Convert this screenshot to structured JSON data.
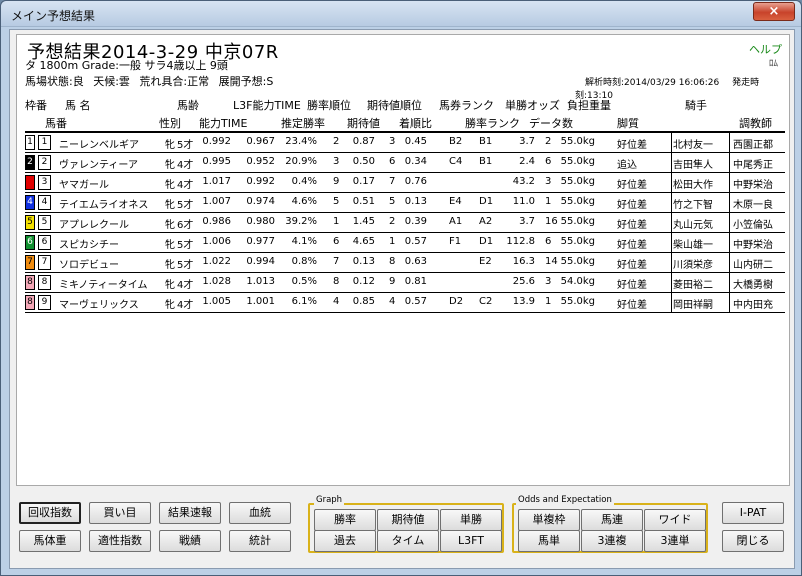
{
  "window": {
    "title": "メイン予想結果",
    "close_icon": "×"
  },
  "race": {
    "title": "予想結果2014-3-29 中京07R",
    "info": "タ 1800m  Grade:一般 サラ4歳以上 9頭",
    "conditions": "馬場状態:良  天候:雲  荒れ具合:正常  展開予想:S",
    "help": "ヘルプ",
    "help_small": "ﾛﾑ",
    "analysis_time": "解析時刻:2014/03/29 16:06:26",
    "post_time": "発走時刻:13:10"
  },
  "headers": {
    "row1": {
      "waku": "枠番",
      "uma": "馬 名",
      "age": "馬齢",
      "l3f": "L3F能力TIME",
      "rate_rank": "勝率順位",
      "exp_rank": "期待値順位",
      "ticket_rank": "馬券ランク",
      "odds": "単勝オッズ",
      "weight": "負担重量",
      "jockey": "騎手"
    },
    "row2": {
      "umaban": "馬番",
      "sex": "性別",
      "ability": "能力TIME",
      "win_rate": "推定勝率",
      "exp": "期待値",
      "finish": "着順比",
      "win_rank": "勝率ランク",
      "data_count": "データ数",
      "leg": "脚質",
      "trainer": "調教師"
    }
  },
  "horses": [
    {
      "waku": "1",
      "waku_color": "#ffffff",
      "waku_text": "#000000",
      "umaban": "1",
      "name": "ニーレンベルギア",
      "sex": "牝",
      "age": "5才",
      "ability": "0.992",
      "l3f": "0.967",
      "rate": "23.4%",
      "rate_rank": "2",
      "exp": "0.87",
      "exp_rank": "3",
      "finish": "0.45",
      "ticket": "B2",
      "win_rank": "B1",
      "odds": "3.7",
      "data": "2",
      "weight": "55.0kg",
      "leg": "好位差",
      "jockey": "北村友一",
      "trainer": "西園正都"
    },
    {
      "waku": "2",
      "waku_color": "#000000",
      "waku_text": "#ffffff",
      "umaban": "2",
      "name": "ヴァレンティーア",
      "sex": "牝",
      "age": "4才",
      "ability": "0.995",
      "l3f": "0.952",
      "rate": "20.9%",
      "rate_rank": "3",
      "exp": "0.50",
      "exp_rank": "6",
      "finish": "0.34",
      "ticket": "C4",
      "win_rank": "B1",
      "odds": "2.4",
      "data": "6",
      "weight": "55.0kg",
      "leg": "追込",
      "jockey": "吉田隼人",
      "trainer": "中尾秀正"
    },
    {
      "waku": "3",
      "waku_color": "#e00000",
      "waku_text": "#e00000",
      "umaban": "3",
      "name": "ヤマガール",
      "sex": "牝",
      "age": "4才",
      "ability": "1.017",
      "l3f": "0.992",
      "rate": "0.4%",
      "rate_rank": "9",
      "exp": "0.17",
      "exp_rank": "7",
      "finish": "0.76",
      "ticket": "",
      "win_rank": "",
      "odds": "43.2",
      "data": "3",
      "weight": "55.0kg",
      "leg": "好位差",
      "jockey": "松田大作",
      "trainer": "中野栄治"
    },
    {
      "waku": "4",
      "waku_color": "#1030e0",
      "waku_text": "#ffffff",
      "umaban": "4",
      "name": "テイエムライオネス",
      "sex": "牝",
      "age": "5才",
      "ability": "1.007",
      "l3f": "0.974",
      "rate": "4.6%",
      "rate_rank": "5",
      "exp": "0.51",
      "exp_rank": "5",
      "finish": "0.13",
      "ticket": "E4",
      "win_rank": "D1",
      "odds": "11.0",
      "data": "1",
      "weight": "55.0kg",
      "leg": "好位差",
      "jockey": "竹之下智",
      "trainer": "木原一良"
    },
    {
      "waku": "5",
      "waku_color": "#f4e000",
      "waku_text": "#000000",
      "umaban": "5",
      "name": "アプレレクール",
      "sex": "牝",
      "age": "6才",
      "ability": "0.986",
      "l3f": "0.980",
      "rate": "39.2%",
      "rate_rank": "1",
      "exp": "1.45",
      "exp_rank": "2",
      "finish": "0.39",
      "ticket": "A1",
      "win_rank": "A2",
      "odds": "3.7",
      "data": "16",
      "weight": "55.0kg",
      "leg": "好位差",
      "jockey": "丸山元気",
      "trainer": "小笠倫弘"
    },
    {
      "waku": "6",
      "waku_color": "#109030",
      "waku_text": "#ffffff",
      "umaban": "6",
      "name": "スピカシチー",
      "sex": "牝",
      "age": "5才",
      "ability": "1.006",
      "l3f": "0.977",
      "rate": "4.1%",
      "rate_rank": "6",
      "exp": "4.65",
      "exp_rank": "1",
      "finish": "0.57",
      "ticket": "F1",
      "win_rank": "D1",
      "odds": "112.8",
      "data": "6",
      "weight": "55.0kg",
      "leg": "好位差",
      "jockey": "柴山雄一",
      "trainer": "中野栄治"
    },
    {
      "waku": "7",
      "waku_color": "#f08c10",
      "waku_text": "#000000",
      "umaban": "7",
      "name": "ソロデビュー",
      "sex": "牝",
      "age": "5才",
      "ability": "1.022",
      "l3f": "0.994",
      "rate": "0.8%",
      "rate_rank": "7",
      "exp": "0.13",
      "exp_rank": "8",
      "finish": "0.63",
      "ticket": "",
      "win_rank": "E2",
      "odds": "16.3",
      "data": "14",
      "weight": "55.0kg",
      "leg": "好位差",
      "jockey": "川須栄彦",
      "trainer": "山内研二"
    },
    {
      "waku": "8",
      "waku_color": "#f4a8b8",
      "waku_text": "#000000",
      "umaban": "8",
      "name": "ミキノティータイム",
      "sex": "牝",
      "age": "4才",
      "ability": "1.028",
      "l3f": "1.013",
      "rate": "0.5%",
      "rate_rank": "8",
      "exp": "0.12",
      "exp_rank": "9",
      "finish": "0.81",
      "ticket": "",
      "win_rank": "",
      "odds": "25.6",
      "data": "3",
      "weight": "54.0kg",
      "leg": "好位差",
      "jockey": "菱田裕二",
      "trainer": "大橋勇樹"
    },
    {
      "waku": "8",
      "waku_color": "#f4a8b8",
      "waku_text": "#000000",
      "umaban": "9",
      "name": "マーヴェリックス",
      "sex": "牝",
      "age": "4才",
      "ability": "1.005",
      "l3f": "1.001",
      "rate": "6.1%",
      "rate_rank": "4",
      "exp": "0.85",
      "exp_rank": "4",
      "finish": "0.57",
      "ticket": "D2",
      "win_rank": "C2",
      "odds": "13.9",
      "data": "1",
      "weight": "55.0kg",
      "leg": "好位差",
      "jockey": "岡田祥嗣",
      "trainer": "中内田充"
    }
  ],
  "buttons": {
    "recovery": "回収指数",
    "kaime": "買い目",
    "results": "結果速報",
    "bloodline": "血統",
    "body_weight": "馬体重",
    "aptitude": "適性指数",
    "record": "戦績",
    "stats": "統計",
    "graph_label": "Graph",
    "graph": {
      "win_rate": "勝率",
      "expectation": "期待値",
      "win": "単勝",
      "past": "過去",
      "time": "タイム",
      "l3ft": "L3FT"
    },
    "odds_label": "Odds and Expectation",
    "odds": {
      "tan_fuku_waku": "単複枠",
      "umaren": "馬連",
      "wide": "ワイド",
      "umatan": "馬単",
      "sanrenpuku": "3連複",
      "sanrentan": "3連単"
    },
    "ipat": "I-PAT",
    "close": "閉じる"
  }
}
